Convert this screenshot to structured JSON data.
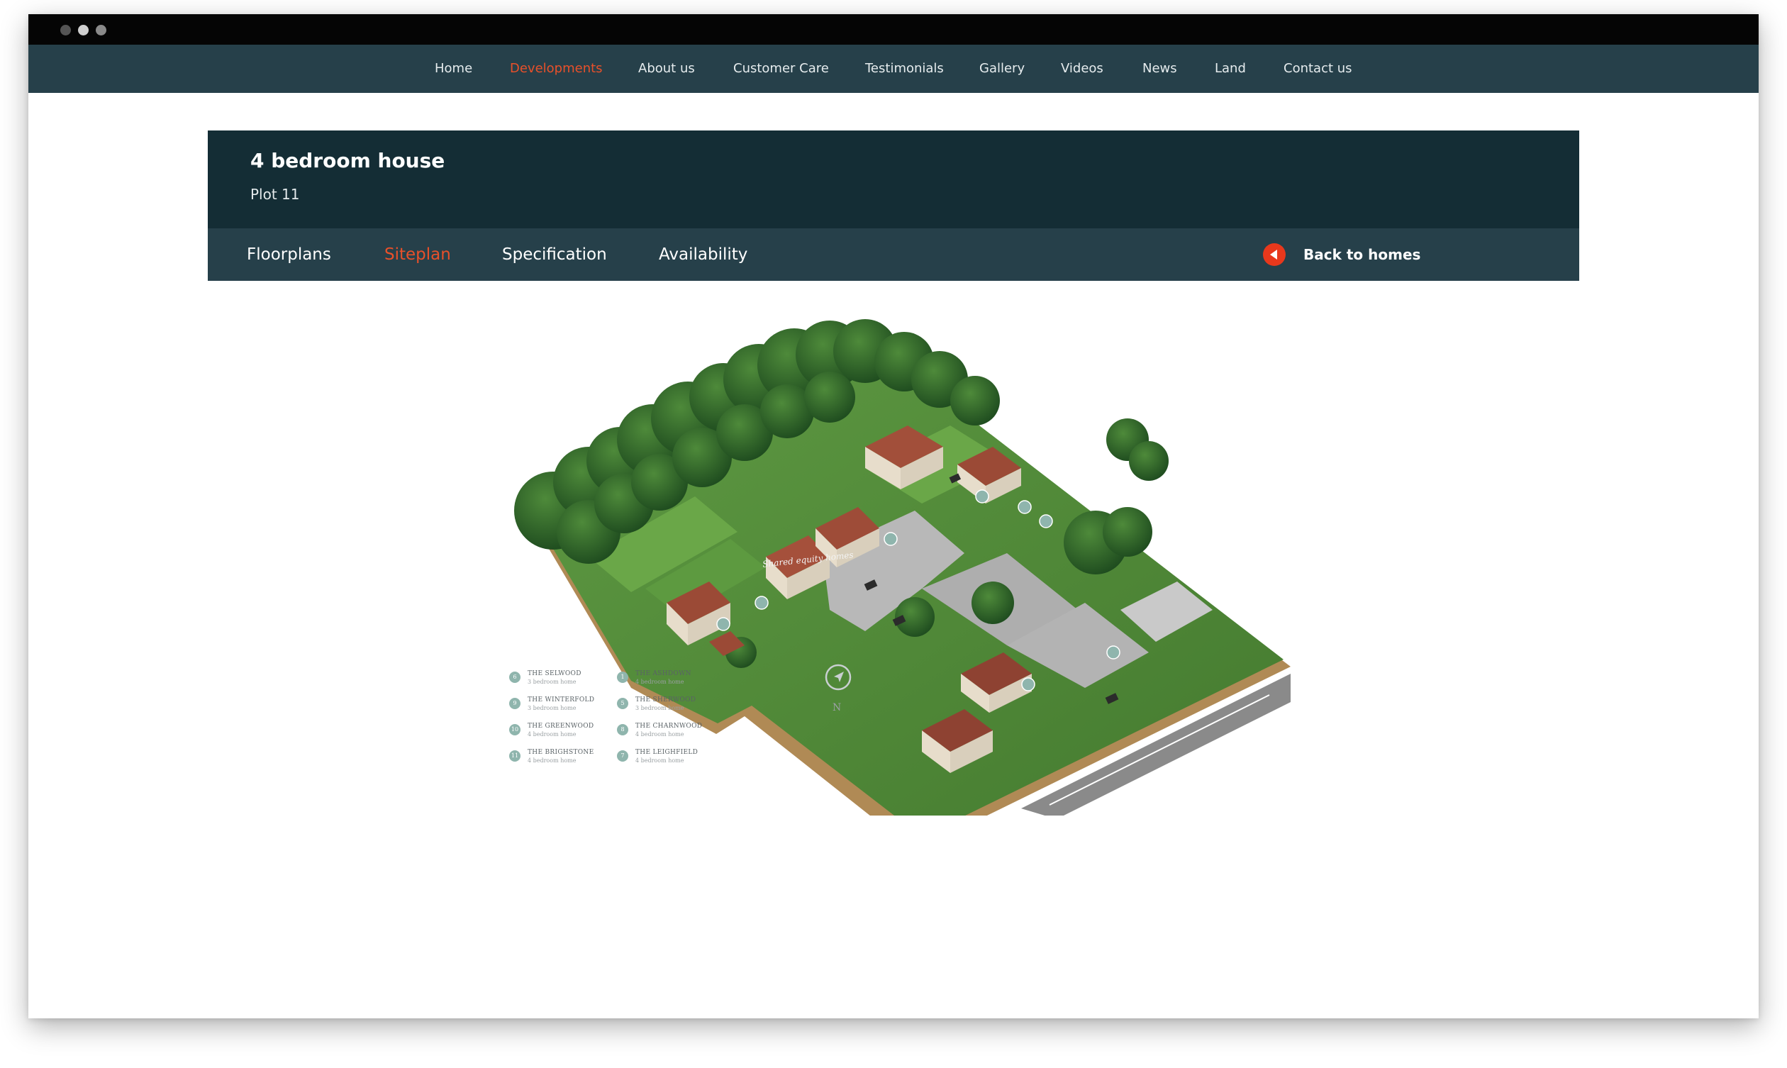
{
  "nav": {
    "items": [
      {
        "label": "Home"
      },
      {
        "label": "Developments"
      },
      {
        "label": "About us"
      },
      {
        "label": "Customer Care"
      },
      {
        "label": "Testimonials"
      },
      {
        "label": "Gallery"
      },
      {
        "label": "Videos"
      },
      {
        "label": "News"
      },
      {
        "label": "Land"
      },
      {
        "label": "Contact us"
      }
    ],
    "active": "Developments"
  },
  "header": {
    "title": "4 bedroom house",
    "subtitle": "Plot 11"
  },
  "tabs": {
    "items": [
      {
        "label": "Floorplans"
      },
      {
        "label": "Siteplan"
      },
      {
        "label": "Specification"
      },
      {
        "label": "Availability"
      }
    ],
    "active": "Siteplan",
    "back_label": "Back to homes"
  },
  "siteplan": {
    "equity_label": "Shared equity homes",
    "compass_label": "N",
    "legend": [
      {
        "num": "6",
        "name": "THE SELWOOD",
        "type": "3 bedroom home"
      },
      {
        "num": "9",
        "name": "THE WINTERFOLD",
        "type": "3 bedroom home"
      },
      {
        "num": "10",
        "name": "THE GREENWOOD",
        "type": "4 bedroom home"
      },
      {
        "num": "11",
        "name": "THE BRIGHSTONE",
        "type": "4 bedroom home"
      },
      {
        "num": "1",
        "name": "THE ASHDOWN",
        "type": "4 bedroom home"
      },
      {
        "num": "5",
        "name": "THE SHERWOOD",
        "type": "3 bedroom home"
      },
      {
        "num": "8",
        "name": "THE CHARNWOOD",
        "type": "4 bedroom home"
      },
      {
        "num": "7",
        "name": "THE LEIGHFIELD",
        "type": "4 bedroom home"
      }
    ],
    "house_markers": [
      "1",
      "2",
      "6",
      "7",
      "8",
      "9",
      "10",
      "11"
    ]
  },
  "colors": {
    "accent": "#e8502a",
    "nav_bg": "#26404a",
    "header_bg": "#142d35",
    "back_icon": "#e8381c"
  },
  "icons": {
    "back": "chevron-left-icon",
    "compass": "compass-icon"
  }
}
